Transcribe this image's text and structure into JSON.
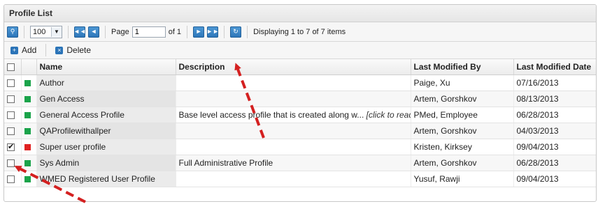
{
  "panel": {
    "title": "Profile List"
  },
  "pager": {
    "page_size": "100",
    "page_label": "Page",
    "page_value": "1",
    "of_label": "of 1",
    "status": "Displaying 1 to 7 of 7 items"
  },
  "toolbar": {
    "add_label": "Add",
    "delete_label": "Delete"
  },
  "table": {
    "columns": [
      "Name",
      "Description",
      "Last Modified By",
      "Last Modified Date"
    ],
    "rows": [
      {
        "checked": false,
        "status_color": "#1aa34a",
        "name": "Author",
        "description": "",
        "description_hint": "",
        "modified_by": "Paige, Xu",
        "modified_date": "07/16/2013"
      },
      {
        "checked": false,
        "status_color": "#1aa34a",
        "name": "Gen Access",
        "description": "",
        "description_hint": "",
        "modified_by": "Artem, Gorshkov",
        "modified_date": "08/13/2013"
      },
      {
        "checked": false,
        "status_color": "#1aa34a",
        "name": "General Access Profile",
        "description": "Base level access profile that is created along w...",
        "description_hint": "[click to read more]",
        "modified_by": "PMed, Employee",
        "modified_date": "06/28/2013"
      },
      {
        "checked": false,
        "status_color": "#1aa34a",
        "name": "QAProfilewithallper",
        "description": "",
        "description_hint": "",
        "modified_by": "Artem, Gorshkov",
        "modified_date": "04/03/2013"
      },
      {
        "checked": true,
        "status_color": "#e02222",
        "name": "Super user profile",
        "description": "",
        "description_hint": "",
        "modified_by": "Kristen, Kirksey",
        "modified_date": "09/04/2013"
      },
      {
        "checked": false,
        "status_color": "#1aa34a",
        "name": "Sys Admin",
        "description": "Full Administrative Profile",
        "description_hint": "",
        "modified_by": "Artem, Gorshkov",
        "modified_date": "06/28/2013"
      },
      {
        "checked": false,
        "status_color": "#1aa34a",
        "name": "WMED Registered User Profile",
        "description": "",
        "description_hint": "",
        "modified_by": "Yusuf, Rawji",
        "modified_date": "09/04/2013"
      }
    ]
  },
  "colors": {
    "accent": "#2b74b8",
    "active_status": "#1aa34a",
    "inactive_status": "#e02222",
    "annotation_arrow": "#d42020"
  }
}
